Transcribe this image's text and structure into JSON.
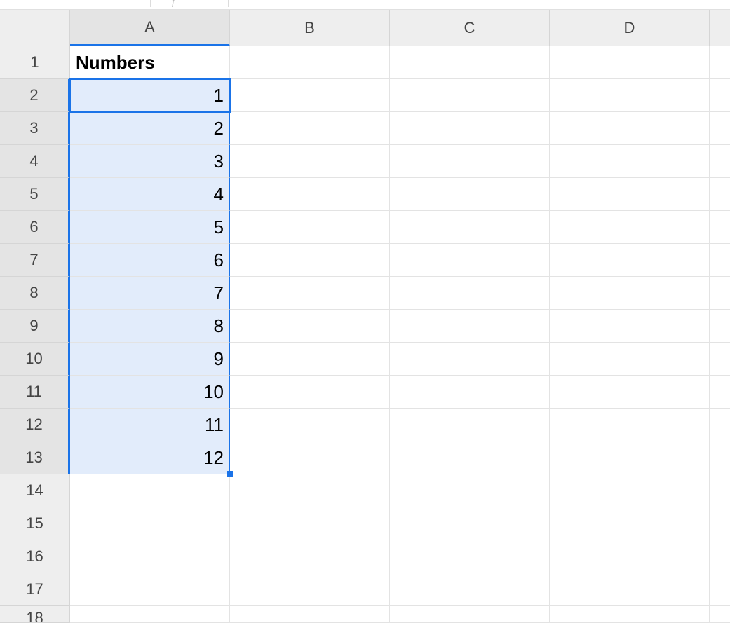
{
  "chart_data": {
    "type": "table",
    "columns": [
      "Numbers"
    ],
    "rows": [
      [
        1
      ],
      [
        2
      ],
      [
        3
      ],
      [
        4
      ],
      [
        5
      ],
      [
        6
      ],
      [
        7
      ],
      [
        8
      ],
      [
        9
      ],
      [
        10
      ],
      [
        11
      ],
      [
        12
      ]
    ]
  },
  "columns": [
    "A",
    "B",
    "C",
    "D",
    ""
  ],
  "rows": [
    {
      "num": "1",
      "cells": [
        "Numbers",
        "",
        "",
        "",
        ""
      ],
      "bold": true,
      "selected": false
    },
    {
      "num": "2",
      "cells": [
        "1",
        "",
        "",
        "",
        ""
      ],
      "bold": false,
      "selected": true,
      "active": true
    },
    {
      "num": "3",
      "cells": [
        "2",
        "",
        "",
        "",
        ""
      ],
      "bold": false,
      "selected": true
    },
    {
      "num": "4",
      "cells": [
        "3",
        "",
        "",
        "",
        ""
      ],
      "bold": false,
      "selected": true
    },
    {
      "num": "5",
      "cells": [
        "4",
        "",
        "",
        "",
        ""
      ],
      "bold": false,
      "selected": true
    },
    {
      "num": "6",
      "cells": [
        "5",
        "",
        "",
        "",
        ""
      ],
      "bold": false,
      "selected": true
    },
    {
      "num": "7",
      "cells": [
        "6",
        "",
        "",
        "",
        ""
      ],
      "bold": false,
      "selected": true
    },
    {
      "num": "8",
      "cells": [
        "7",
        "",
        "",
        "",
        ""
      ],
      "bold": false,
      "selected": true
    },
    {
      "num": "9",
      "cells": [
        "8",
        "",
        "",
        "",
        ""
      ],
      "bold": false,
      "selected": true
    },
    {
      "num": "10",
      "cells": [
        "9",
        "",
        "",
        "",
        ""
      ],
      "bold": false,
      "selected": true
    },
    {
      "num": "11",
      "cells": [
        "10",
        "",
        "",
        "",
        ""
      ],
      "bold": false,
      "selected": true
    },
    {
      "num": "12",
      "cells": [
        "11",
        "",
        "",
        "",
        ""
      ],
      "bold": false,
      "selected": true
    },
    {
      "num": "13",
      "cells": [
        "12",
        "",
        "",
        "",
        ""
      ],
      "bold": false,
      "selected": true,
      "last": true
    },
    {
      "num": "14",
      "cells": [
        "",
        "",
        "",
        "",
        ""
      ],
      "bold": false,
      "selected": false
    },
    {
      "num": "15",
      "cells": [
        "",
        "",
        "",
        "",
        ""
      ],
      "bold": false,
      "selected": false
    },
    {
      "num": "16",
      "cells": [
        "",
        "",
        "",
        "",
        ""
      ],
      "bold": false,
      "selected": false
    },
    {
      "num": "17",
      "cells": [
        "",
        "",
        "",
        "",
        ""
      ],
      "bold": false,
      "selected": false
    },
    {
      "num": "18",
      "cells": [
        "",
        "",
        "",
        "",
        ""
      ],
      "bold": false,
      "selected": false,
      "partial": true
    }
  ],
  "selection": {
    "col": 0
  }
}
